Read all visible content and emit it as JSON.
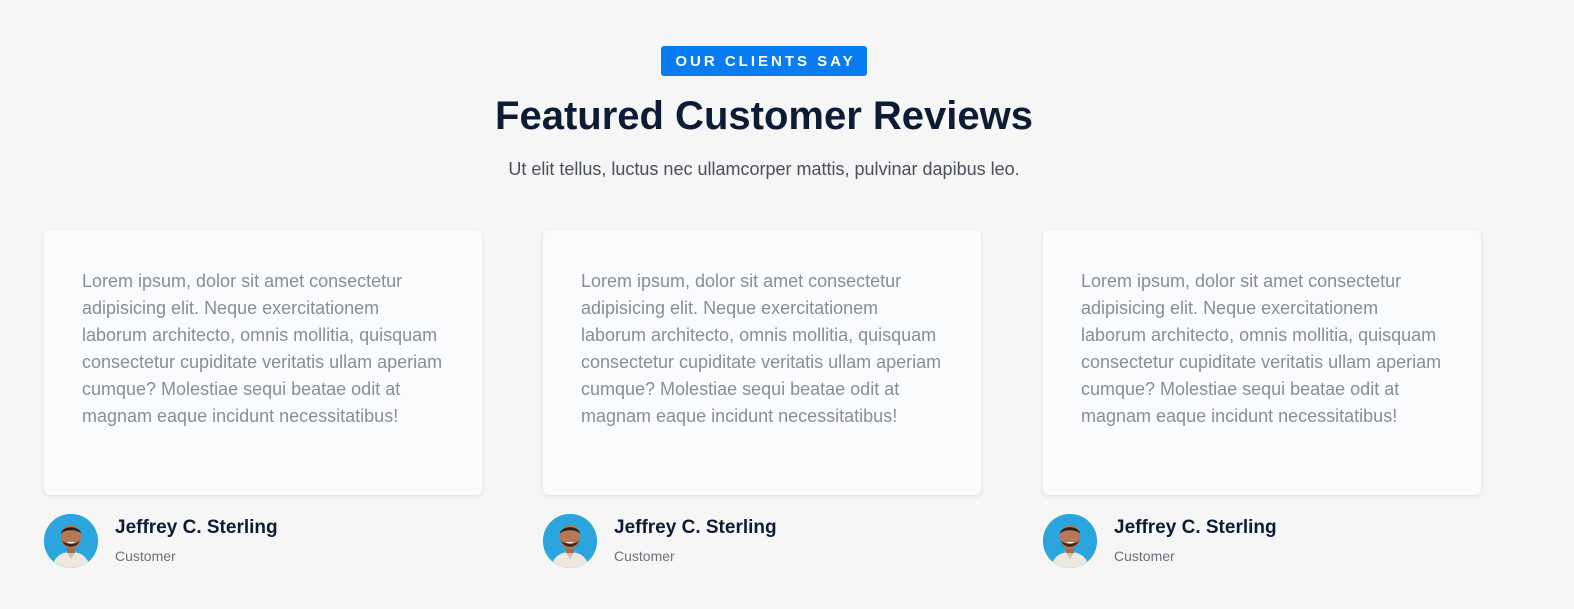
{
  "header": {
    "badge": "OUR CLIENTS SAY",
    "title": "Featured Customer Reviews",
    "subtitle": "Ut elit tellus, luctus nec ullamcorper mattis, pulvinar dapibus leo."
  },
  "reviews": [
    {
      "text": "Lorem ipsum, dolor sit amet consectetur adipisicing elit. Neque exercitationem laborum architecto, omnis mollitia, quisquam consectetur cupiditate veritatis ullam aperiam cumque? Molestiae sequi beatae odit at magnam eaque incidunt necessitatibus!",
      "name": "Jeffrey C. Sterling",
      "role": "Customer",
      "avatar_icon": "customer-portrait"
    },
    {
      "text": "Lorem ipsum, dolor sit amet consectetur adipisicing elit. Neque exercitationem laborum architecto, omnis mollitia, quisquam consectetur cupiditate veritatis ullam aperiam cumque? Molestiae sequi beatae odit at magnam eaque incidunt necessitatibus!",
      "name": "Jeffrey C. Sterling",
      "role": "Customer",
      "avatar_icon": "customer-portrait"
    },
    {
      "text": "Lorem ipsum, dolor sit amet consectetur adipisicing elit. Neque exercitationem laborum architecto, omnis mollitia, quisquam consectetur cupiditate veritatis ullam aperiam cumque? Molestiae sequi beatae odit at magnam eaque incidunt necessitatibus!",
      "name": "Jeffrey C. Sterling",
      "role": "Customer",
      "avatar_icon": "customer-portrait"
    }
  ],
  "colors": {
    "accent": "#0a7cf2",
    "heading": "#0d1c34",
    "background": "#f6f6f7",
    "card": "#fafbfc",
    "avatar_background": "#2aa5de"
  }
}
